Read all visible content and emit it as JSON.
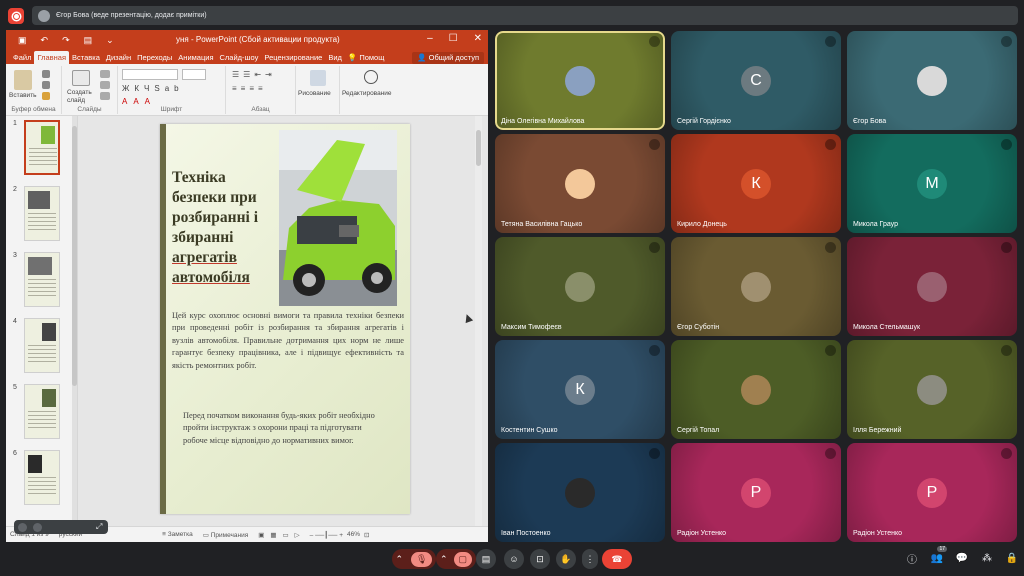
{
  "meeting": {
    "presenter_label": "Єгор Бова (веде презентацію, додає примітки)"
  },
  "ppt": {
    "title": "уня - PowerPoint (Сбой активации продукта)",
    "tabs": [
      "Файл",
      "Главная",
      "Вставка",
      "Дизайн",
      "Переходы",
      "Анимация",
      "Слайд-шоу",
      "Рецензирование",
      "Вид"
    ],
    "active_tab": "Главная",
    "help_label": "Помощ",
    "share_label": "Общий доступ",
    "ribbon": {
      "paste": "Вставить",
      "create_slide": "Создать слайд",
      "drawing": "Рисование",
      "editing": "Редактирование",
      "groups": [
        "Буфер обмена",
        "Слайды",
        "Шрифт",
        "Абзац"
      ]
    },
    "thumbnails": [
      "1",
      "2",
      "3",
      "4",
      "5",
      "6"
    ],
    "slide": {
      "title_plain": "Техніка безпеки при розбиранні і збиранні",
      "title_underlined": "агрегатів автомобіля",
      "paragraph1": "Цей курс охоплює основні вимоги та правила техніки безпеки при проведенні робіт із розбирання та збирання агрегатів і вузлів автомобіля. Правильне дотримання цих норм не лише гарантує безпеку працівника, але і підвищує ефективність та якість ремонтних робіт.",
      "paragraph2": "Перед початком виконання будь-яких робіт необхідно пройти інструктаж з охорони праці та підготувати робоче місце відповідно до нормативних вимог."
    },
    "status": {
      "slide_info": "Слайд 1 из 9",
      "language": "русский",
      "notes": "Заметка",
      "comments": "Примечания",
      "zoom": "46%"
    }
  },
  "participants": [
    {
      "name": "Діна Олегівна Михайлова",
      "initial": "",
      "bg": "#6f7b2e",
      "avatar": "#8aa0c0",
      "active": true
    },
    {
      "name": "Сергій Гордієнко",
      "initial": "С",
      "bg": "#2f5b66",
      "avatar": "#6c7a80"
    },
    {
      "name": "Єгор Бова",
      "initial": "",
      "bg": "#3b6a74",
      "avatar": "#d9d9d9"
    },
    {
      "name": "Тетяна Василівна Гацько",
      "initial": "",
      "bg": "#7a4a33",
      "avatar": "#f3c89a"
    },
    {
      "name": "Кирило Донець",
      "initial": "К",
      "bg": "#b0381e",
      "avatar": "#d4502a"
    },
    {
      "name": "Микола Граур",
      "initial": "М",
      "bg": "#136c5e",
      "avatar": "#1f8a78"
    },
    {
      "name": "Максим Тимофеєв",
      "initial": "",
      "bg": "#4f5a2a",
      "avatar": "#8a8f6a"
    },
    {
      "name": "Єгор Суботін",
      "initial": "",
      "bg": "#6a5b32",
      "avatar": "#a09070"
    },
    {
      "name": "Микола Стельмашук",
      "initial": "",
      "bg": "#7a2238",
      "avatar": "#9a6070"
    },
    {
      "name": "Костентин Сушко",
      "initial": "К",
      "bg": "#2f4e66",
      "avatar": "#6b7d8c"
    },
    {
      "name": "Сергій Топал",
      "initial": "",
      "bg": "#4d5d26",
      "avatar": "#a08050"
    },
    {
      "name": "Ілля Бережний",
      "initial": "",
      "bg": "#566228",
      "avatar": "#8c8c80"
    },
    {
      "name": "Іван Постоенко",
      "initial": "",
      "bg": "#1c3a55",
      "avatar": "#2a2a2a"
    },
    {
      "name": "Радіон Устенко",
      "initial": "Р",
      "bg": "#a8275a",
      "avatar": "#d2456e"
    },
    {
      "name": "Радіон Устенко",
      "initial": "Р",
      "bg": "#a8275a",
      "avatar": "#d2456e"
    }
  ],
  "controls": {
    "end_call_color": "#ea4335",
    "participants_badge": "17"
  }
}
